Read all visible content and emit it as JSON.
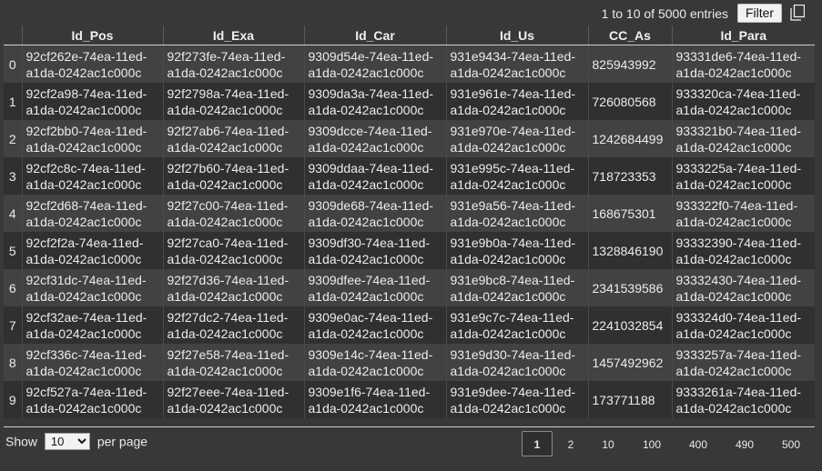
{
  "pagination_info": "1 to 10 of 5000 entries",
  "filter_label": "Filter",
  "columns": [
    "",
    "Id_Pos",
    "Id_Exa",
    "Id_Car",
    "Id_Us",
    "CC_As",
    "Id_Para"
  ],
  "rows": [
    [
      "0",
      "92cf262e-74ea-11ed-a1da-0242ac1c000c",
      "92f273fe-74ea-11ed-a1da-0242ac1c000c",
      "9309d54e-74ea-11ed-a1da-0242ac1c000c",
      "931e9434-74ea-11ed-a1da-0242ac1c000c",
      "825943992",
      "93331de6-74ea-11ed-a1da-0242ac1c000c"
    ],
    [
      "1",
      "92cf2a98-74ea-11ed-a1da-0242ac1c000c",
      "92f2798a-74ea-11ed-a1da-0242ac1c000c",
      "9309da3a-74ea-11ed-a1da-0242ac1c000c",
      "931e961e-74ea-11ed-a1da-0242ac1c000c",
      "726080568",
      "933320ca-74ea-11ed-a1da-0242ac1c000c"
    ],
    [
      "2",
      "92cf2bb0-74ea-11ed-a1da-0242ac1c000c",
      "92f27ab6-74ea-11ed-a1da-0242ac1c000c",
      "9309dcce-74ea-11ed-a1da-0242ac1c000c",
      "931e970e-74ea-11ed-a1da-0242ac1c000c",
      "1242684499",
      "933321b0-74ea-11ed-a1da-0242ac1c000c"
    ],
    [
      "3",
      "92cf2c8c-74ea-11ed-a1da-0242ac1c000c",
      "92f27b60-74ea-11ed-a1da-0242ac1c000c",
      "9309ddaa-74ea-11ed-a1da-0242ac1c000c",
      "931e995c-74ea-11ed-a1da-0242ac1c000c",
      "718723353",
      "9333225a-74ea-11ed-a1da-0242ac1c000c"
    ],
    [
      "4",
      "92cf2d68-74ea-11ed-a1da-0242ac1c000c",
      "92f27c00-74ea-11ed-a1da-0242ac1c000c",
      "9309de68-74ea-11ed-a1da-0242ac1c000c",
      "931e9a56-74ea-11ed-a1da-0242ac1c000c",
      "168675301",
      "933322f0-74ea-11ed-a1da-0242ac1c000c"
    ],
    [
      "5",
      "92cf2f2a-74ea-11ed-a1da-0242ac1c000c",
      "92f27ca0-74ea-11ed-a1da-0242ac1c000c",
      "9309df30-74ea-11ed-a1da-0242ac1c000c",
      "931e9b0a-74ea-11ed-a1da-0242ac1c000c",
      "1328846190",
      "93332390-74ea-11ed-a1da-0242ac1c000c"
    ],
    [
      "6",
      "92cf31dc-74ea-11ed-a1da-0242ac1c000c",
      "92f27d36-74ea-11ed-a1da-0242ac1c000c",
      "9309dfee-74ea-11ed-a1da-0242ac1c000c",
      "931e9bc8-74ea-11ed-a1da-0242ac1c000c",
      "2341539586",
      "93332430-74ea-11ed-a1da-0242ac1c000c"
    ],
    [
      "7",
      "92cf32ae-74ea-11ed-a1da-0242ac1c000c",
      "92f27dc2-74ea-11ed-a1da-0242ac1c000c",
      "9309e0ac-74ea-11ed-a1da-0242ac1c000c",
      "931e9c7c-74ea-11ed-a1da-0242ac1c000c",
      "2241032854",
      "933324d0-74ea-11ed-a1da-0242ac1c000c"
    ],
    [
      "8",
      "92cf336c-74ea-11ed-a1da-0242ac1c000c",
      "92f27e58-74ea-11ed-a1da-0242ac1c000c",
      "9309e14c-74ea-11ed-a1da-0242ac1c000c",
      "931e9d30-74ea-11ed-a1da-0242ac1c000c",
      "1457492962",
      "9333257a-74ea-11ed-a1da-0242ac1c000c"
    ],
    [
      "9",
      "92cf527a-74ea-11ed-a1da-0242ac1c000c",
      "92f27eee-74ea-11ed-a1da-0242ac1c000c",
      "9309e1f6-74ea-11ed-a1da-0242ac1c000c",
      "931e9dee-74ea-11ed-a1da-0242ac1c000c",
      "173771188",
      "9333261a-74ea-11ed-a1da-0242ac1c000c"
    ]
  ],
  "footer": {
    "show_label": "Show",
    "per_page_label": "per page",
    "page_size": "10",
    "pages": [
      "1",
      "2",
      "10",
      "100",
      "400",
      "490",
      "500"
    ],
    "active_page": "1"
  },
  "icons": {
    "copy": "copy-icon"
  },
  "colors": {
    "background": "#383838",
    "row_even": "#424242",
    "row_odd": "#303030"
  }
}
